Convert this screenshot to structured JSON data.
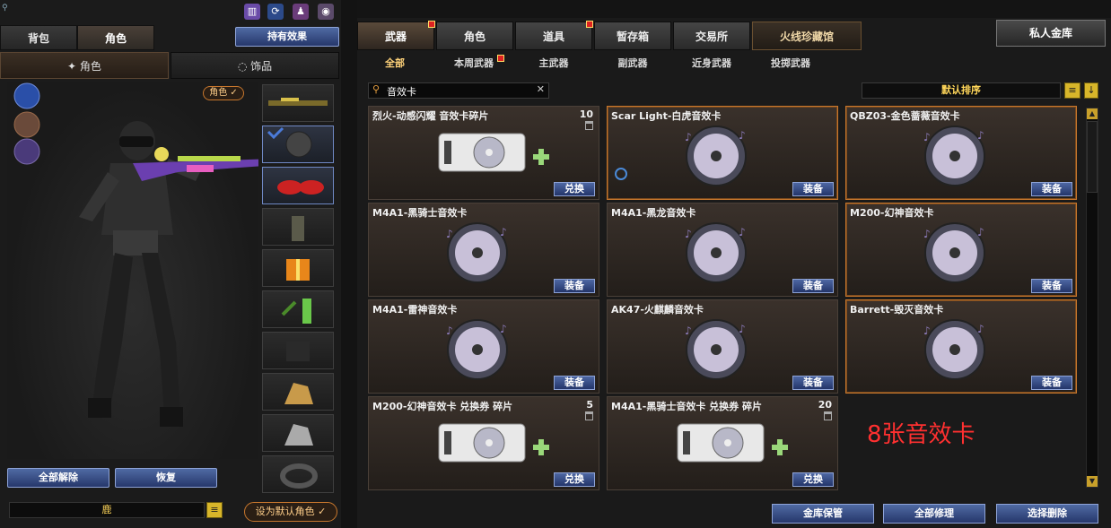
{
  "left": {
    "tabs": [
      "背包",
      "角色"
    ],
    "active_tab": "角色",
    "effects_button": "持有效果",
    "subtabs": [
      "角色",
      "饰品"
    ],
    "role_badge": "角色",
    "clear_all": "全部解除",
    "restore": "恢复",
    "char_name": "鹿",
    "set_default": "设为默认角色"
  },
  "right": {
    "tabs": [
      "武器",
      "角色",
      "道具",
      "暂存箱",
      "交易所",
      "火线珍藏馆"
    ],
    "private_vault": "私人金库",
    "subcategories": [
      "全部",
      "本周武器",
      "主武器",
      "副武器",
      "近身武器",
      "投掷武器"
    ],
    "search_value": "音效卡",
    "sort_label": "默认排序",
    "items": [
      {
        "name": "烈火-动感闪耀 音效卡碎片",
        "count": "10",
        "action": "兑换",
        "kind": "ticket"
      },
      {
        "name": "Scar Light-白虎音效卡",
        "count": "",
        "action": "装备",
        "kind": "disc"
      },
      {
        "name": "QBZ03-金色蔷薇音效卡",
        "count": "",
        "action": "装备",
        "kind": "disc"
      },
      {
        "name": "M4A1-黑骑士音效卡",
        "count": "",
        "action": "装备",
        "kind": "disc"
      },
      {
        "name": "M4A1-黑龙音效卡",
        "count": "",
        "action": "装备",
        "kind": "disc"
      },
      {
        "name": "M200-幻神音效卡",
        "count": "",
        "action": "装备",
        "kind": "disc"
      },
      {
        "name": "M4A1-雷神音效卡",
        "count": "",
        "action": "装备",
        "kind": "disc"
      },
      {
        "name": "AK47-火麒麟音效卡",
        "count": "",
        "action": "装备",
        "kind": "disc"
      },
      {
        "name": "Barrett-毁灭音效卡",
        "count": "",
        "action": "装备",
        "kind": "disc"
      },
      {
        "name": "M200-幻神音效卡 兑换券 碎片",
        "count": "5",
        "action": "兑换",
        "kind": "ticket"
      },
      {
        "name": "M4A1-黑骑士音效卡 兑换券 碎片",
        "count": "20",
        "action": "兑换",
        "kind": "ticket"
      }
    ],
    "annotation": "8张音效卡",
    "bottom_buttons": [
      "金库保管",
      "全部修理",
      "选择删除"
    ]
  },
  "colors": {
    "accent_orange": "#c7772d",
    "button_blue": "#3a528a",
    "annotation_red": "#ff3030"
  }
}
